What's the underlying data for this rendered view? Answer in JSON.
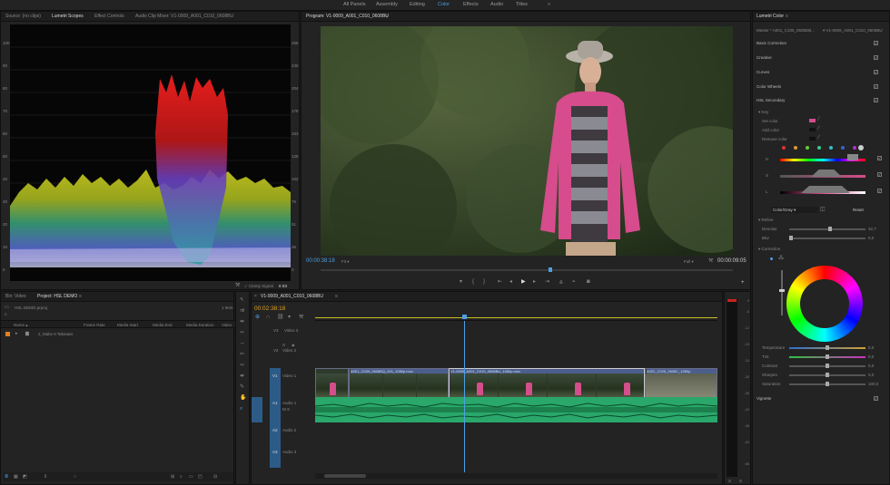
{
  "workspace_tabs": [
    "All Panels",
    "Assembly",
    "Editing",
    "Color",
    "Effects",
    "Audio",
    "Titles"
  ],
  "workspace_active": "Color",
  "workspace_more": "»",
  "scopes_panel": {
    "tabs": [
      "Source: (no clips)",
      "Lumetri Scopes",
      "Effect Controls",
      "Audio Clip Mixer: V1-0009_A001_C010_0608BU"
    ],
    "active_tab": "Lumetri Scopes",
    "left_scale": [
      "100",
      "90",
      "80",
      "70",
      "60",
      "50",
      "40",
      "30",
      "20",
      "10",
      "0"
    ],
    "right_scale": [
      "255",
      "230",
      "204",
      "178",
      "153",
      "128",
      "102",
      "76",
      "51",
      "26",
      "0"
    ],
    "clamp_label": "Clamp Signal",
    "bit_depth": "8 Bit"
  },
  "program_monitor": {
    "title": "Program: V1-0009_A001_C010_0608BU",
    "timecode": "00:00:38:18",
    "fit": "Fit",
    "quality": "Full",
    "duration": "00:00:09:05"
  },
  "project_panel": {
    "tabs": [
      "Bin: Video",
      "Project: HSL DEMO"
    ],
    "active_tab": "Project: HSL DEMO",
    "file": "HSL DEMO.prproj",
    "item_count": "1 Item",
    "columns": [
      "Name",
      "Frame Rate",
      "Media Start",
      "Media End",
      "Media Duration",
      "Video"
    ],
    "items": [
      {
        "name": "2_Make It Takeaws"
      }
    ]
  },
  "timeline": {
    "tab": "V1-0009_A001_C010_0608BU",
    "timecode": "00:02:38:18",
    "tracks": [
      {
        "id": "V3",
        "name": "Video 3"
      },
      {
        "id": "V2",
        "name": "Video 2"
      },
      {
        "id": "V1",
        "name": "Video 1"
      },
      {
        "id": "A1",
        "name": "Audio 1"
      },
      {
        "id": "A2",
        "name": "Audio 2"
      },
      {
        "id": "A3",
        "name": "Audio 3"
      }
    ],
    "clips": [
      "A001_C039_0608BQ_001_1080p.mov",
      "V1-0009_A001_C010_0608BU_1080p.mov",
      "A002_C026_0608C_1080p"
    ],
    "meter_scale": [
      "0",
      "-6",
      "-12",
      "-18",
      "-24",
      "-30",
      "-36",
      "-42",
      "-48",
      "-54",
      "dB"
    ]
  },
  "lumetri_color": {
    "title": "Lumetri Color",
    "master": "Master * A001_C109_0608DB...",
    "clip": "V1-0009_A001_C010_0608BU",
    "sections": [
      "Basic Correction",
      "Creative",
      "Curves",
      "Color Wheels",
      "HSL Secondary"
    ],
    "key_label": "Key",
    "set_color": "Set color",
    "add_color": "Add color",
    "remove_color": "Remove color",
    "h_label": "H",
    "s_label": "S",
    "l_label": "L",
    "display_mode": "Color/Gray",
    "reset_label": "Reset",
    "refine_label": "Refine",
    "denoise": {
      "label": "Denoise",
      "value": "32,7"
    },
    "blur": {
      "label": "Blur",
      "value": "0,0"
    },
    "correction_label": "Correction",
    "adjustments": [
      {
        "label": "Temperature",
        "value": "0,0"
      },
      {
        "label": "Tint",
        "value": "0,0"
      },
      {
        "label": "Contrast",
        "value": "0,0"
      },
      {
        "label": "Sharpen",
        "value": "0,0"
      },
      {
        "label": "Saturation",
        "value": "100,0"
      }
    ],
    "vignette_label": "Vignette",
    "swatch_colors": [
      "#d33",
      "#d93",
      "#6c3",
      "#3c8",
      "#3bc",
      "#36c",
      "#a3c",
      "#ccc"
    ]
  }
}
